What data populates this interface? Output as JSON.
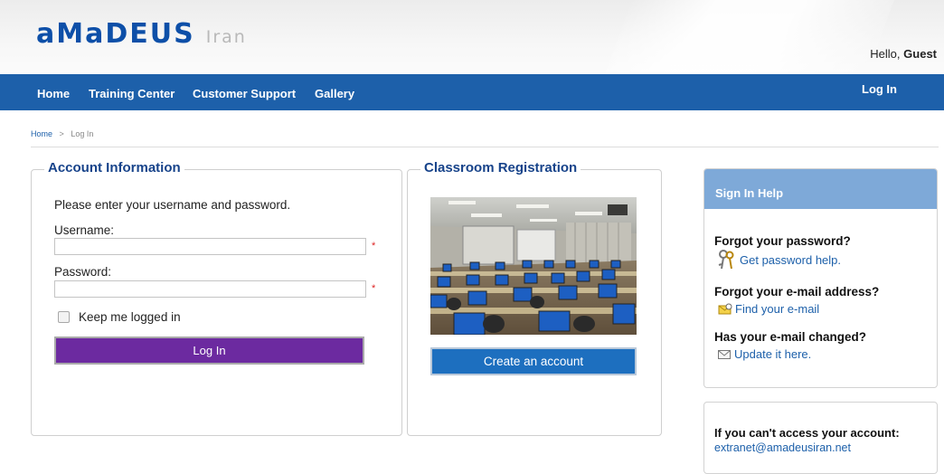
{
  "brand": {
    "name": "aMaDEUS",
    "region": "Iran"
  },
  "user": {
    "greeting_prefix": "Hello,",
    "name": "Guest"
  },
  "nav": {
    "items": [
      {
        "label": "Home"
      },
      {
        "label": "Training Center"
      },
      {
        "label": "Customer Support"
      },
      {
        "label": "Gallery"
      }
    ],
    "login_label": "Log In"
  },
  "breadcrumb": {
    "home": "Home",
    "separator": ">",
    "current": "Log In"
  },
  "account": {
    "legend": "Account Information",
    "instructions": "Please enter your username and password.",
    "username_label": "Username:",
    "username_value": "",
    "password_label": "Password:",
    "password_value": "",
    "required_marker": "*",
    "remember_label": "Keep me logged in",
    "remember_checked": false,
    "login_button": "Log In"
  },
  "classroom": {
    "legend": "Classroom Registration",
    "create_button": "Create an account"
  },
  "help": {
    "title": "Sign In Help",
    "sections": [
      {
        "question": "Forgot your password?",
        "link": "Get password help.",
        "icon": "keys-icon"
      },
      {
        "question": "Forgot your e-mail address?",
        "link": "Find your e-mail",
        "icon": "mail-search-icon"
      },
      {
        "question": "Has your e-mail changed?",
        "link": "Update it here.",
        "icon": "envelope-icon"
      }
    ]
  },
  "access": {
    "title": "If you can't access your account:",
    "email": "extranet@amadeusiran.net"
  },
  "colors": {
    "nav_blue": "#1d60aa",
    "login_purple": "#6c2aa0",
    "create_blue": "#1d6fbf",
    "help_header": "#7ea9d8",
    "legend_blue": "#17438a"
  }
}
